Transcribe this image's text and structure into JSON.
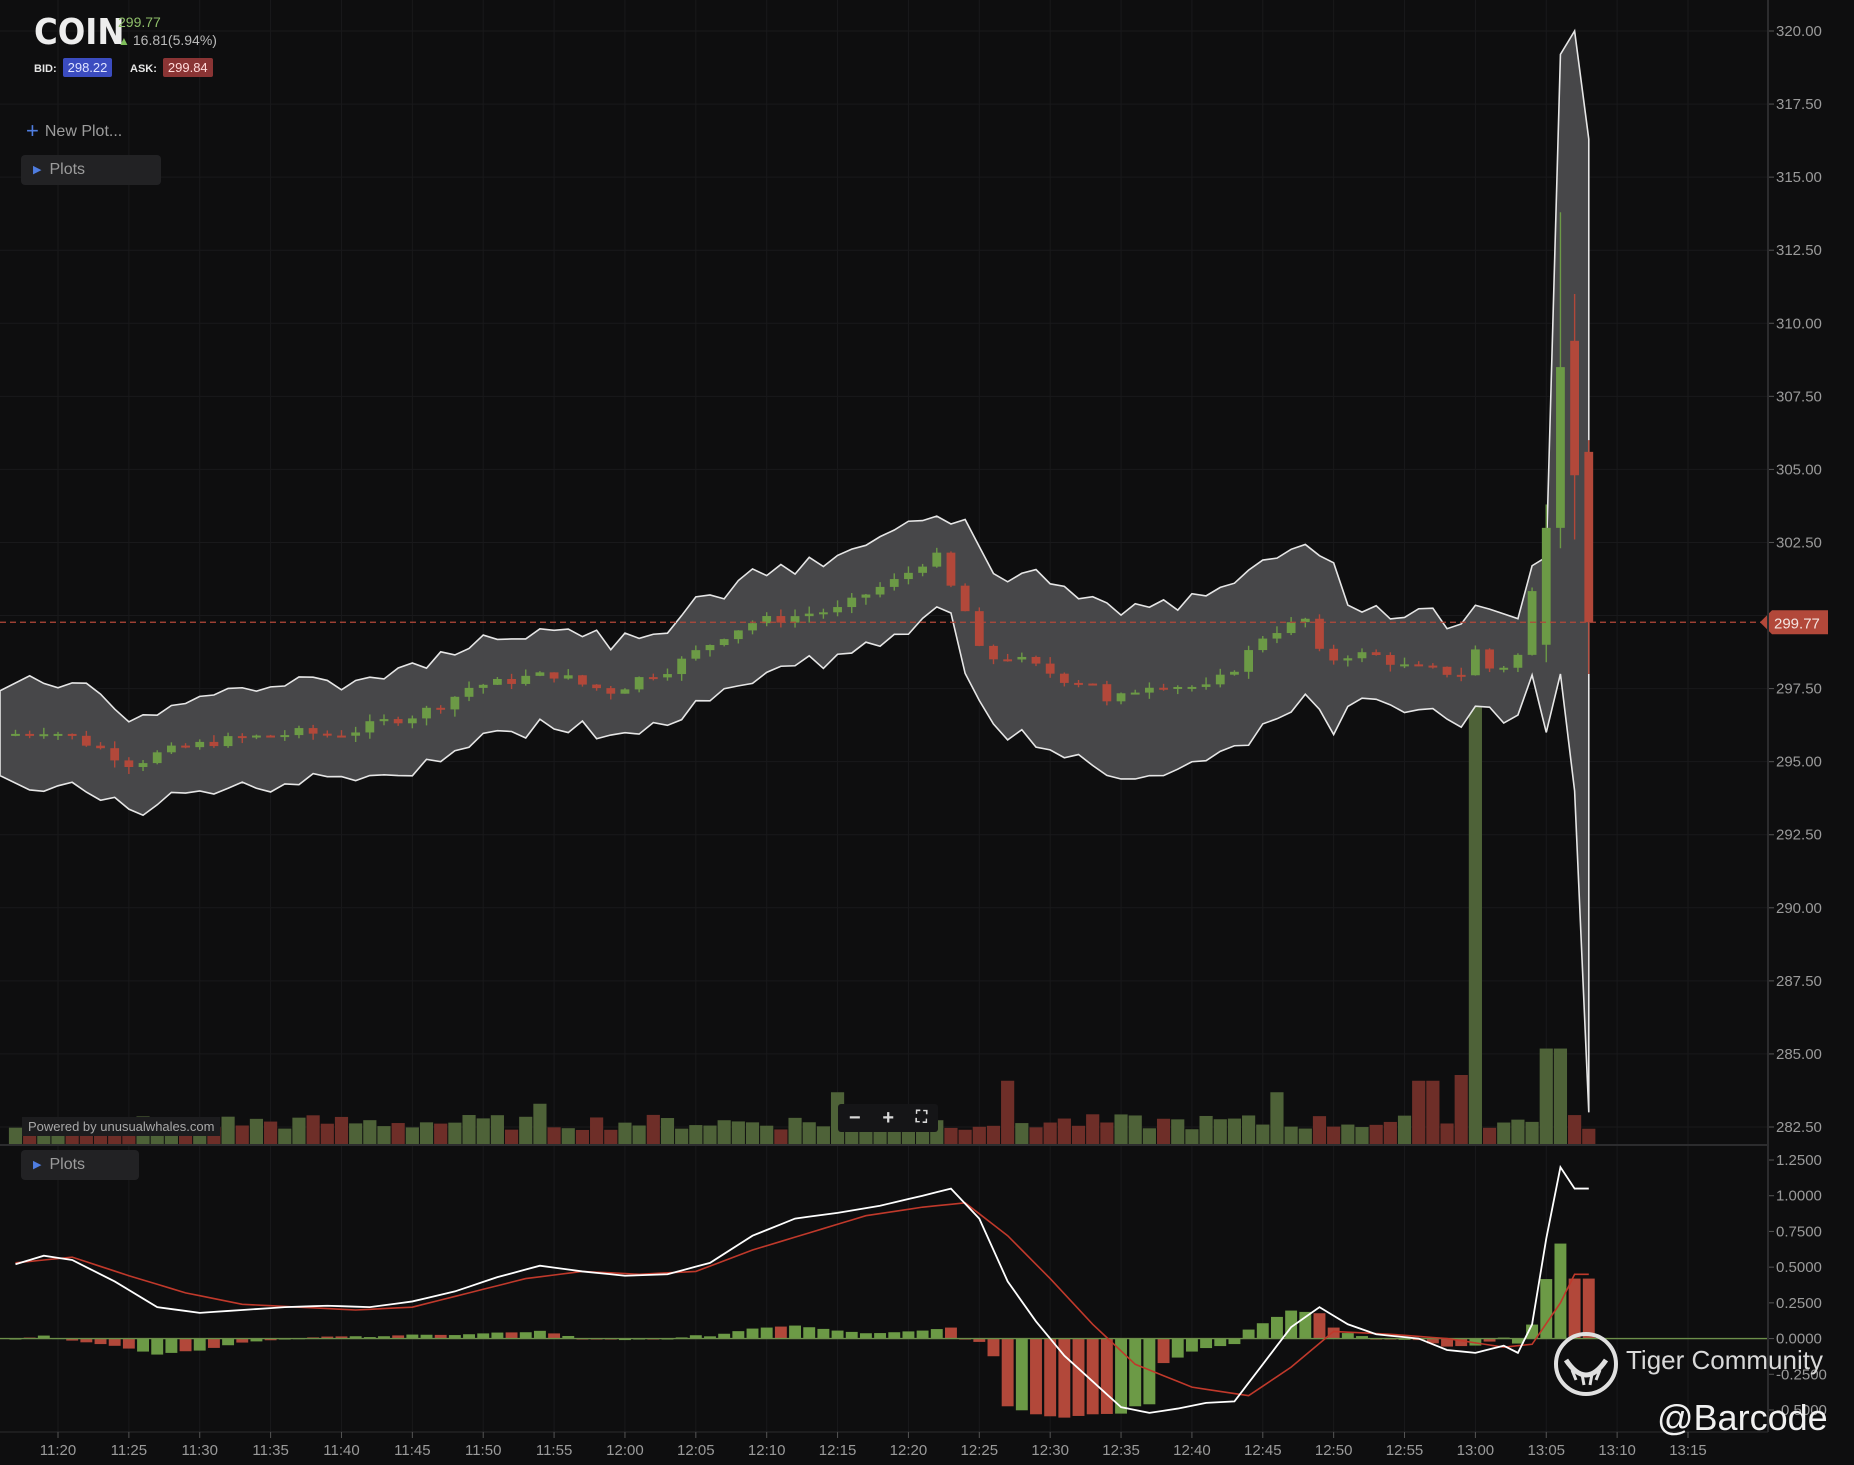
{
  "ticker": {
    "symbol": "COIN",
    "last": "299.77",
    "change": "16.81(5.94%)",
    "bid_label": "BID:",
    "bid": "298.22",
    "ask_label": "ASK:",
    "ask": "299.84"
  },
  "controls": {
    "new_plot": "New Plot...",
    "plots_top": "Plots",
    "plots_bottom": "Plots",
    "zoom_out": "−",
    "zoom_in": "+",
    "fullscreen": "⛶"
  },
  "footer": {
    "powered_by": "Powered by unusualwhales.com"
  },
  "watermark": {
    "community": "Tiger Community",
    "handle": "@Barcode"
  },
  "colors": {
    "up": "#6c9a46",
    "down": "#b2483a",
    "band_fill": "#474749",
    "band_line": "#e6e6e6",
    "price_line": "#b2483a",
    "macd_line": "#ffffff",
    "signal_line": "#c0392b",
    "volume_up": "#4e6238",
    "volume_down": "#6e2e28"
  },
  "chart_data": {
    "type": "candlestick",
    "price_axis": {
      "ylim": [
        282.5,
        320.0
      ],
      "ticks": [
        "320.00",
        "317.50",
        "315.00",
        "312.50",
        "310.00",
        "307.50",
        "305.00",
        "302.50",
        "300.00",
        "297.50",
        "295.00",
        "292.50",
        "290.00",
        "287.50",
        "285.00",
        "282.50"
      ],
      "last_price_label": "299.77",
      "last_price": 299.77
    },
    "macd_axis": {
      "ylim": [
        -0.5,
        1.25
      ],
      "ticks": [
        "1.2500",
        "1.0000",
        "0.7500",
        "0.5000",
        "0.2500",
        "0.0000",
        "-0.2500",
        "-0.5000"
      ]
    },
    "time_axis": {
      "ticks": [
        "11:20",
        "11:25",
        "11:30",
        "11:35",
        "11:40",
        "11:45",
        "11:50",
        "11:55",
        "12:00",
        "12:05",
        "12:10",
        "12:15",
        "12:20",
        "12:25",
        "12:30",
        "12:35",
        "12:40",
        "12:45",
        "12:50",
        "12:55",
        "13:00",
        "13:05",
        "13:10",
        "13:15"
      ]
    },
    "price_anchors": [
      [
        "11:17",
        295.9
      ],
      [
        "11:20",
        296.1
      ],
      [
        "11:22",
        295.8
      ],
      [
        "11:24",
        295.4
      ],
      [
        "11:26",
        294.9
      ],
      [
        "11:28",
        295.3
      ],
      [
        "11:30",
        295.5
      ],
      [
        "11:32",
        295.7
      ],
      [
        "11:34",
        295.8
      ],
      [
        "11:36",
        295.9
      ],
      [
        "11:38",
        296.0
      ],
      [
        "11:40",
        295.9
      ],
      [
        "11:42",
        296.1
      ],
      [
        "11:44",
        296.4
      ],
      [
        "11:46",
        296.6
      ],
      [
        "11:48",
        297.0
      ],
      [
        "11:50",
        297.6
      ],
      [
        "11:52",
        297.7
      ],
      [
        "11:54",
        297.9
      ],
      [
        "11:56",
        298.0
      ],
      [
        "11:58",
        297.6
      ],
      [
        "12:00",
        297.4
      ],
      [
        "12:02",
        297.9
      ],
      [
        "12:04",
        298.2
      ],
      [
        "12:06",
        298.8
      ],
      [
        "12:08",
        299.4
      ],
      [
        "12:10",
        299.8
      ],
      [
        "12:12",
        299.9
      ],
      [
        "12:14",
        300.1
      ],
      [
        "12:16",
        300.2
      ],
      [
        "12:18",
        300.8
      ],
      [
        "12:20",
        301.2
      ],
      [
        "12:22",
        301.9
      ],
      [
        "12:23",
        302.0
      ],
      [
        "12:24",
        300.7
      ],
      [
        "12:25",
        300.0
      ],
      [
        "12:26",
        298.5
      ],
      [
        "12:28",
        298.6
      ],
      [
        "12:30",
        298.2
      ],
      [
        "12:32",
        297.8
      ],
      [
        "12:34",
        297.7
      ],
      [
        "12:35",
        296.8
      ],
      [
        "12:36",
        297.3
      ],
      [
        "12:38",
        297.7
      ],
      [
        "12:40",
        297.6
      ],
      [
        "12:42",
        297.5
      ],
      [
        "12:44",
        298.3
      ],
      [
        "12:46",
        299.4
      ],
      [
        "12:48",
        299.7
      ],
      [
        "12:49",
        299.9
      ],
      [
        "12:50",
        298.4
      ],
      [
        "12:52",
        298.7
      ],
      [
        "12:54",
        298.6
      ],
      [
        "12:56",
        298.2
      ],
      [
        "12:58",
        298.1
      ],
      [
        "13:00",
        298.0
      ],
      [
        "13:01",
        299.0
      ],
      [
        "13:02",
        298.0
      ],
      [
        "13:04",
        298.7
      ],
      [
        "13:05",
        301.3
      ],
      [
        "13:06",
        308.5
      ],
      [
        "13:07",
        309.2
      ],
      [
        "13:08",
        304.8
      ],
      [
        "13:08.5",
        299.77
      ]
    ],
    "volume_spikes": [
      [
        "13:00",
        0.4
      ],
      [
        "13:05.5",
        0.083
      ],
      [
        "12:59",
        0.06
      ],
      [
        "12:56.5",
        0.055
      ],
      [
        "12:27",
        0.055
      ],
      [
        "12:15",
        0.045
      ],
      [
        "11:54",
        0.035
      ],
      [
        "12:46",
        0.045
      ]
    ],
    "macd_anchors": [
      [
        "11:17",
        0.52
      ],
      [
        "11:19",
        0.58
      ],
      [
        "11:21",
        0.55
      ],
      [
        "11:24",
        0.4
      ],
      [
        "11:27",
        0.22
      ],
      [
        "11:30",
        0.18
      ],
      [
        "11:33",
        0.2
      ],
      [
        "11:36",
        0.22
      ],
      [
        "11:39",
        0.23
      ],
      [
        "11:42",
        0.22
      ],
      [
        "11:45",
        0.26
      ],
      [
        "11:48",
        0.33
      ],
      [
        "11:51",
        0.43
      ],
      [
        "11:54",
        0.51
      ],
      [
        "11:57",
        0.47
      ],
      [
        "12:00",
        0.44
      ],
      [
        "12:03",
        0.45
      ],
      [
        "12:06",
        0.53
      ],
      [
        "12:09",
        0.72
      ],
      [
        "12:12",
        0.84
      ],
      [
        "12:15",
        0.88
      ],
      [
        "12:18",
        0.93
      ],
      [
        "12:21",
        1.0
      ],
      [
        "12:23",
        1.05
      ],
      [
        "12:25",
        0.84
      ],
      [
        "12:27",
        0.4
      ],
      [
        "12:29",
        0.12
      ],
      [
        "12:31",
        -0.12
      ],
      [
        "12:33",
        -0.3
      ],
      [
        "12:35",
        -0.48
      ],
      [
        "12:37",
        -0.52
      ],
      [
        "12:39",
        -0.49
      ],
      [
        "12:41",
        -0.45
      ],
      [
        "12:43",
        -0.44
      ],
      [
        "12:45",
        -0.18
      ],
      [
        "12:47",
        0.08
      ],
      [
        "12:49",
        0.22
      ],
      [
        "12:51",
        0.1
      ],
      [
        "12:53",
        0.03
      ],
      [
        "12:56",
        0.0
      ],
      [
        "12:58",
        -0.08
      ],
      [
        "13:00",
        -0.1
      ],
      [
        "13:02",
        -0.05
      ],
      [
        "13:03",
        -0.1
      ],
      [
        "13:04",
        0.1
      ],
      [
        "13:05",
        0.7
      ],
      [
        "13:06",
        1.2
      ],
      [
        "13:07",
        1.05
      ]
    ],
    "signal_anchors": [
      [
        "11:17",
        0.53
      ],
      [
        "11:21",
        0.57
      ],
      [
        "11:25",
        0.44
      ],
      [
        "11:29",
        0.32
      ],
      [
        "11:33",
        0.24
      ],
      [
        "11:37",
        0.22
      ],
      [
        "11:41",
        0.2
      ],
      [
        "11:45",
        0.22
      ],
      [
        "11:49",
        0.32
      ],
      [
        "11:53",
        0.42
      ],
      [
        "11:57",
        0.47
      ],
      [
        "12:01",
        0.45
      ],
      [
        "12:05",
        0.47
      ],
      [
        "12:09",
        0.62
      ],
      [
        "12:13",
        0.74
      ],
      [
        "12:17",
        0.86
      ],
      [
        "12:21",
        0.92
      ],
      [
        "12:24",
        0.95
      ],
      [
        "12:27",
        0.72
      ],
      [
        "12:30",
        0.42
      ],
      [
        "12:33",
        0.1
      ],
      [
        "12:36",
        -0.18
      ],
      [
        "12:40",
        -0.34
      ],
      [
        "12:44",
        -0.4
      ],
      [
        "12:47",
        -0.2
      ],
      [
        "12:50",
        0.05
      ],
      [
        "12:54",
        0.03
      ],
      [
        "12:58",
        0.0
      ],
      [
        "13:02",
        -0.06
      ],
      [
        "13:04",
        -0.04
      ],
      [
        "13:06",
        0.25
      ],
      [
        "13:07",
        0.45
      ]
    ]
  }
}
